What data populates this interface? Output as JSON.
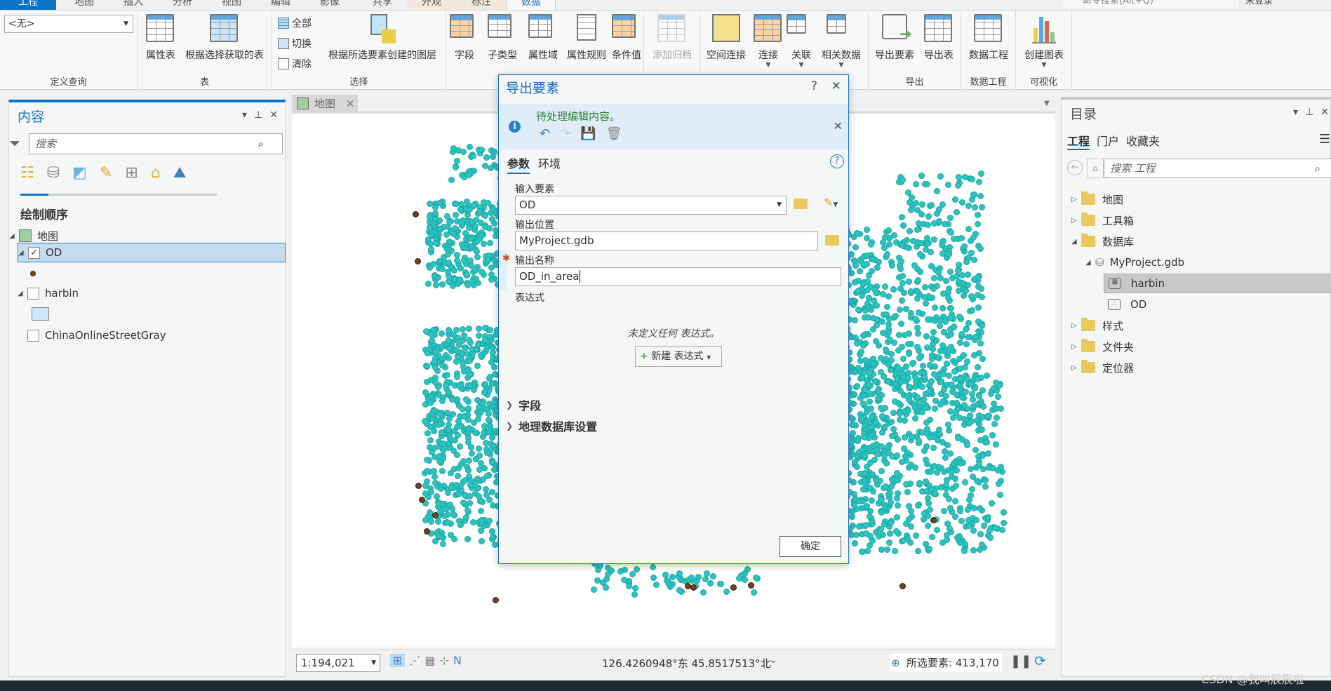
{
  "ribbon_tabs": [
    {
      "label": "工程",
      "state": "project"
    },
    {
      "label": "地图"
    },
    {
      "label": "插入"
    },
    {
      "label": "分析"
    },
    {
      "label": "视图"
    },
    {
      "label": "编辑"
    },
    {
      "label": "影像"
    },
    {
      "label": "共享"
    },
    {
      "label": "外观",
      "state": "contextual"
    },
    {
      "label": "标注",
      "state": "contextual"
    },
    {
      "label": "数据",
      "state": "selected"
    }
  ],
  "command_search": {
    "placeholder": "命令搜索(Alt+Q)"
  },
  "login": {
    "label": "未登录"
  },
  "ribbon": {
    "definition_query": {
      "value": "<无>",
      "group_label": "定义查询"
    },
    "table_group": {
      "label": "表",
      "buttons": [
        "属性表",
        "根据选择获取的表"
      ]
    },
    "selection_group": {
      "label": "选择",
      "small_buttons": [
        "全部",
        "切换",
        "清除"
      ],
      "big_button": "根据所选要素创建的图层"
    },
    "design_group": {
      "buttons": [
        "字段",
        "子类型",
        "属性域",
        "属性规则",
        "条件值"
      ]
    },
    "archive": {
      "label": "添加归档"
    },
    "relate_group": {
      "buttons": [
        "空间连接",
        "连接",
        "关联",
        "相关数据"
      ]
    },
    "export_group": {
      "label": "导出",
      "buttons": [
        "导出要素",
        "导出表"
      ]
    },
    "data_engineering_group": {
      "label": "数据工程",
      "button": "数据工程"
    },
    "visualize_group": {
      "label": "可视化",
      "button": "创建图表"
    }
  },
  "contents_pane": {
    "title": "内容",
    "search_placeholder": "搜索",
    "section_title": "绘制顺序",
    "map_name": "地图",
    "layers": [
      {
        "name": "OD",
        "checked": true,
        "selected": true,
        "symbol": "brown-point"
      },
      {
        "name": "harbin",
        "checked": false,
        "symbol": "light-blue-polygon"
      },
      {
        "name": "ChinaOnlineStreetGray",
        "checked": false
      }
    ]
  },
  "map_view": {
    "tab_label": "地图",
    "scale": "1:194,021",
    "coordinates": "126.4260948°东 45.8517513°北",
    "selected_features_label": "所选要素: 413,170",
    "point_color": "#2cc4c0",
    "outlier_color": "#7a3d17"
  },
  "dialog": {
    "title": "导出要素",
    "help_label": "?",
    "info_message": "待处理编辑内容。",
    "tabs": [
      "参数",
      "环境"
    ],
    "active_tab": "参数",
    "input_features_label": "输入要素",
    "input_features_value": "OD",
    "output_location_label": "输出位置",
    "output_location_value": "MyProject.gdb",
    "output_name_label": "输出名称",
    "output_name_value": "OD_in_area",
    "expression_label": "表达式",
    "no_expression_text": "未定义任何 表达式。",
    "new_expression_button": "新建 表达式",
    "sections": [
      "字段",
      "地理数据库设置"
    ],
    "ok_button": "确定"
  },
  "catalog_pane": {
    "title": "目录",
    "tabs": [
      "工程",
      "门户",
      "收藏夹"
    ],
    "search_placeholder": "搜索 工程",
    "items": [
      {
        "label": "地图",
        "expanded": false
      },
      {
        "label": "工具箱",
        "expanded": false
      },
      {
        "label": "数据库",
        "expanded": true
      },
      {
        "label": "MyProject.gdb",
        "expanded": true
      },
      {
        "label": "harbin",
        "selected": true
      },
      {
        "label": "OD"
      },
      {
        "label": "样式",
        "expanded": false
      },
      {
        "label": "文件夹",
        "expanded": false
      },
      {
        "label": "定位器",
        "expanded": false
      }
    ]
  },
  "watermark": "CSDN @我叫辰辰啦"
}
